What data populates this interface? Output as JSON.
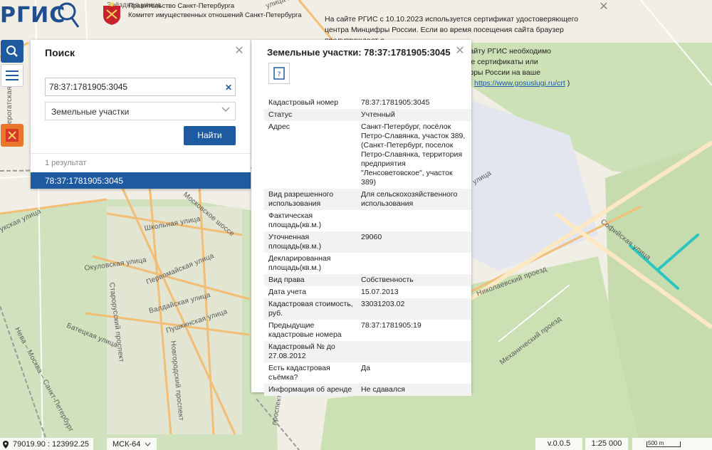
{
  "header": {
    "logo_text": "РГИС",
    "gov_line1": "Правительство Санкт-Петербурга",
    "gov_line2": "Комитет имущественных отношений Санкт-Петербурга"
  },
  "notice": {
    "part1": "На сайте РГИС с 10.10.2023 используется сертификат удостоверяющего центра Минцифры России. Если во время посещения сайта браузер предупреждает о",
    "part2": "б                                                 доступа к сайту РГИС необходимо",
    "part3": "у                                                 ечественные сертификаты или",
    "part4": "                                                 нтра Минцифры России на ваше",
    "link": "https://www.gosuslugi.ru/crt",
    "after_link": ")"
  },
  "search_panel": {
    "title": "Поиск",
    "input_value": "78:37:1781905:3045",
    "select_value": "Земельные участки",
    "find_label": "Найти",
    "result_count": "1 результат",
    "result_item": "78:37:1781905:3045"
  },
  "info_panel": {
    "title": "Земельные участки: 78:37:1781905:3045",
    "rows": [
      {
        "key": "Кадастровый номер",
        "value": "78:37:1781905:3045"
      },
      {
        "key": "Статус",
        "value": "Учтенный"
      },
      {
        "key": "Адрес",
        "value": "Санкт-Петербург, посёлок Петро-Славянка, участок 389, (Санкт-Петербург, поселок Петро-Славянка, территория предприятия \"Ленсоветовское\", участок 389)"
      },
      {
        "key": "Вид разрешенного использования",
        "value": "Для сельскохозяйственного использования"
      },
      {
        "key": "Фактическая площадь(кв.м.)",
        "value": ""
      },
      {
        "key": "Уточненная площадь(кв.м.)",
        "value": "29060"
      },
      {
        "key": "Декларированная площадь(кв.м.)",
        "value": ""
      },
      {
        "key": "Вид права",
        "value": "Собственность"
      },
      {
        "key": "Дата учета",
        "value": "15.07.2013"
      },
      {
        "key": "Кадастровая стоимость, руб.",
        "value": "33031203.02"
      },
      {
        "key": "Предыдущие кадастровые номера",
        "value": "78:37:1781905:19"
      },
      {
        "key": "Кадастровый № до 27.08.2012",
        "value": ""
      },
      {
        "key": "Есть кадастровая съёмка?",
        "value": "Да"
      },
      {
        "key": "Информация об аренде",
        "value": "Не сдавался"
      }
    ]
  },
  "map_labels": {
    "zvezdnaya": "Звёздная улица",
    "yaroslava": "улица Ярослава",
    "shkolnaya": "Школьная улица",
    "okulovskaya": "Окуловская улица",
    "pervomayskaya": "Первомайская улица",
    "valdayskaya": "Валдайская улица",
    "pushkinskaya": "Пушкинская улица",
    "batetskaya": "Батецкая улица",
    "starorusskiy": "Старорусский проспект",
    "novgorodskiy": "Новгородский проспект",
    "moskovskoe": "Московское шоссе",
    "ulitsa": "улица",
    "sofiyskaya": "Софийская улица",
    "nikolaevskiy": "Николаевский проезд",
    "mehanicheskiy": "Механический проезд",
    "prospekt": "проспект",
    "neva": "Нева – Москва – Санкт-Петербург",
    "ukskaya": "укская улица",
    "erogatskaya": "ерогатская"
  },
  "footer": {
    "coords": "79019.90 : 123992.25",
    "crs": "МСК-64",
    "version": "v.0.0.5",
    "scale": "1:25 000",
    "scale_bar": "500 m"
  },
  "colors": {
    "brand": "#1e5aa0",
    "accent_orange": "#e9762a",
    "parcel": "#2cc6c0",
    "road_orange": "#f4c07a",
    "green": "#c9dfb4"
  }
}
